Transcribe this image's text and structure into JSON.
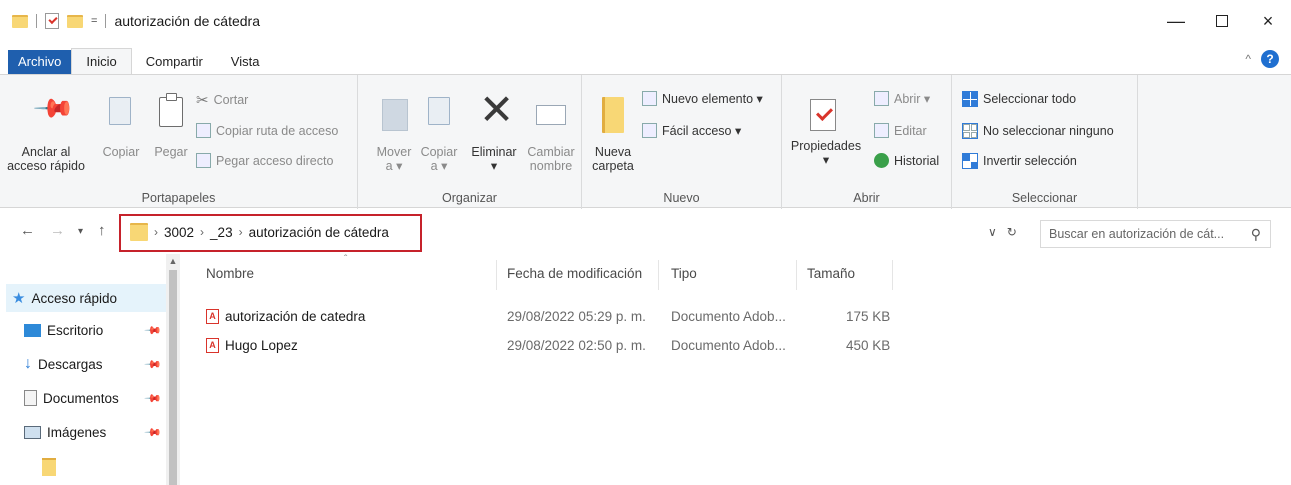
{
  "window": {
    "title": "autorización de cátedra",
    "qa_dropdown": "=",
    "minimize": "—",
    "close": "×"
  },
  "tabs": [
    {
      "label": "Archivo"
    },
    {
      "label": "Inicio"
    },
    {
      "label": "Compartir"
    },
    {
      "label": "Vista"
    }
  ],
  "ribbon": {
    "portapapeles": {
      "label": "Portapapeles",
      "pin_line1": "Anclar al",
      "pin_line2": "acceso rápido",
      "copy": "Copiar",
      "paste": "Pegar",
      "cut": "Cortar",
      "copy_path": "Copiar ruta de acceso",
      "paste_shortcut": "Pegar acceso directo"
    },
    "organizar": {
      "label": "Organizar",
      "move_line1": "Mover",
      "move_line2": "a ▾",
      "copyto_line1": "Copiar",
      "copyto_line2": "a ▾",
      "delete_line1": "Eliminar",
      "delete_line2": "▾",
      "rename_line1": "Cambiar",
      "rename_line2": "nombre"
    },
    "nuevo": {
      "label": "Nuevo",
      "new_folder_line1": "Nueva",
      "new_folder_line2": "carpeta",
      "new_item": "Nuevo elemento ▾",
      "easy_access": "Fácil acceso ▾"
    },
    "abrir": {
      "label": "Abrir",
      "properties_line1": "Propiedades",
      "properties_line2": "▾",
      "open": "Abrir ▾",
      "edit": "Editar",
      "history": "Historial"
    },
    "seleccionar": {
      "label": "Seleccionar",
      "select_all": "Seleccionar todo",
      "select_none": "No seleccionar ninguno",
      "invert": "Invertir selección"
    }
  },
  "address": {
    "crumbs": [
      "3002",
      "_23",
      "autorización de cátedra"
    ],
    "refresh_glyph": "↻"
  },
  "search": {
    "placeholder": "Buscar en autorización de cát..."
  },
  "sidebar": {
    "items": [
      {
        "label": "Acceso rápido"
      },
      {
        "label": "Escritorio"
      },
      {
        "label": "Descargas"
      },
      {
        "label": "Documentos"
      },
      {
        "label": "Imágenes"
      }
    ]
  },
  "columns": {
    "name": "Nombre",
    "date": "Fecha de modificación",
    "type": "Tipo",
    "size": "Tamaño"
  },
  "files": [
    {
      "name": "autorización de catedra",
      "date": "29/08/2022 05:29 p. m.",
      "type": "Documento Adob...",
      "size": "175 KB"
    },
    {
      "name": "Hugo Lopez",
      "date": "29/08/2022 02:50 p. m.",
      "type": "Documento Adob...",
      "size": "450 KB"
    }
  ],
  "colors": {
    "file_tab": "#1f5fae",
    "highlight_box": "#c6222b",
    "accent": "#2f7bd8"
  }
}
